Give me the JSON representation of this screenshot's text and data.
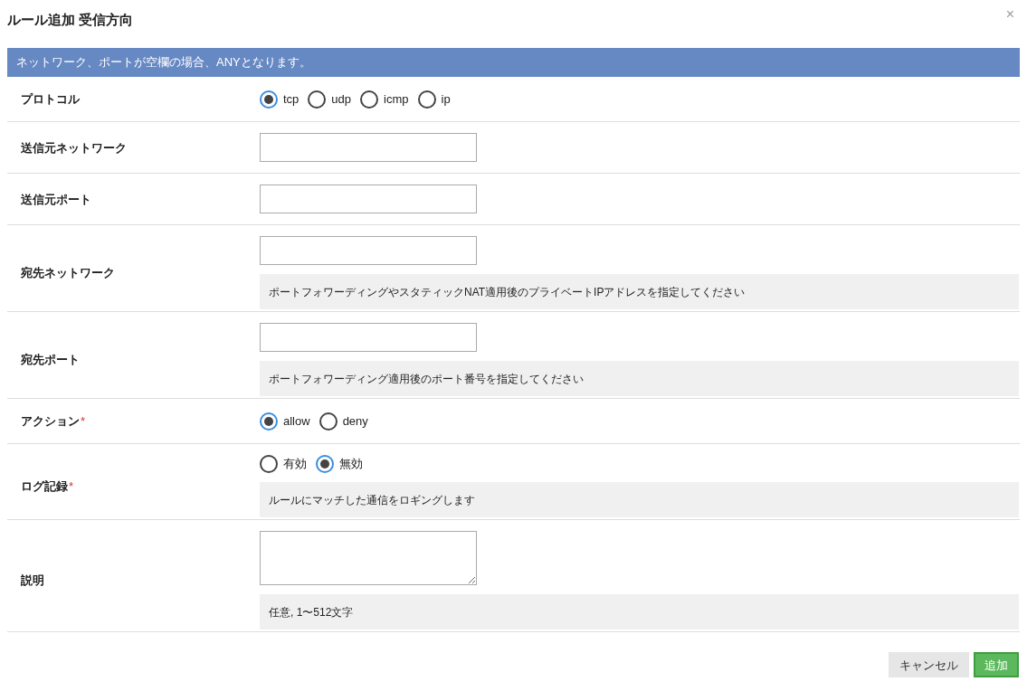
{
  "dialog": {
    "title": "ルール追加 受信方向",
    "close": "×"
  },
  "required_mark": "*",
  "notice": "ネットワーク、ポートが空欄の場合、ANYとなります。",
  "rows": [
    {
      "label": "プロトコル",
      "kind": "radio",
      "required": false,
      "options": [
        {
          "label": "tcp",
          "selected": true
        },
        {
          "label": "udp",
          "selected": false
        },
        {
          "label": "icmp",
          "selected": false
        },
        {
          "label": "ip",
          "selected": false
        }
      ]
    },
    {
      "label": "送信元ネットワーク",
      "kind": "text",
      "required": false
    },
    {
      "label": "送信元ポート",
      "kind": "text",
      "required": false
    },
    {
      "label": "宛先ネットワーク",
      "kind": "text",
      "required": false,
      "help": "ポートフォワーディングやスタティックNAT適用後のプライベートIPアドレスを指定してください"
    },
    {
      "label": "宛先ポート",
      "kind": "text",
      "required": false,
      "help": "ポートフォワーディング適用後のポート番号を指定してください"
    },
    {
      "label": "アクション",
      "kind": "radio",
      "required": true,
      "options": [
        {
          "label": "allow",
          "selected": true
        },
        {
          "label": "deny",
          "selected": false
        }
      ]
    },
    {
      "label": "ログ記録",
      "kind": "radio",
      "required": true,
      "options": [
        {
          "label": "有効",
          "selected": false
        },
        {
          "label": "無効",
          "selected": true
        }
      ],
      "help": "ルールにマッチした通信をロギングします"
    },
    {
      "label": "説明",
      "kind": "textarea",
      "required": false,
      "help": "任意, 1〜512文字"
    }
  ],
  "buttons": [
    {
      "label": "キャンセル",
      "kind": "secondary"
    },
    {
      "label": "追加",
      "kind": "primary"
    }
  ]
}
